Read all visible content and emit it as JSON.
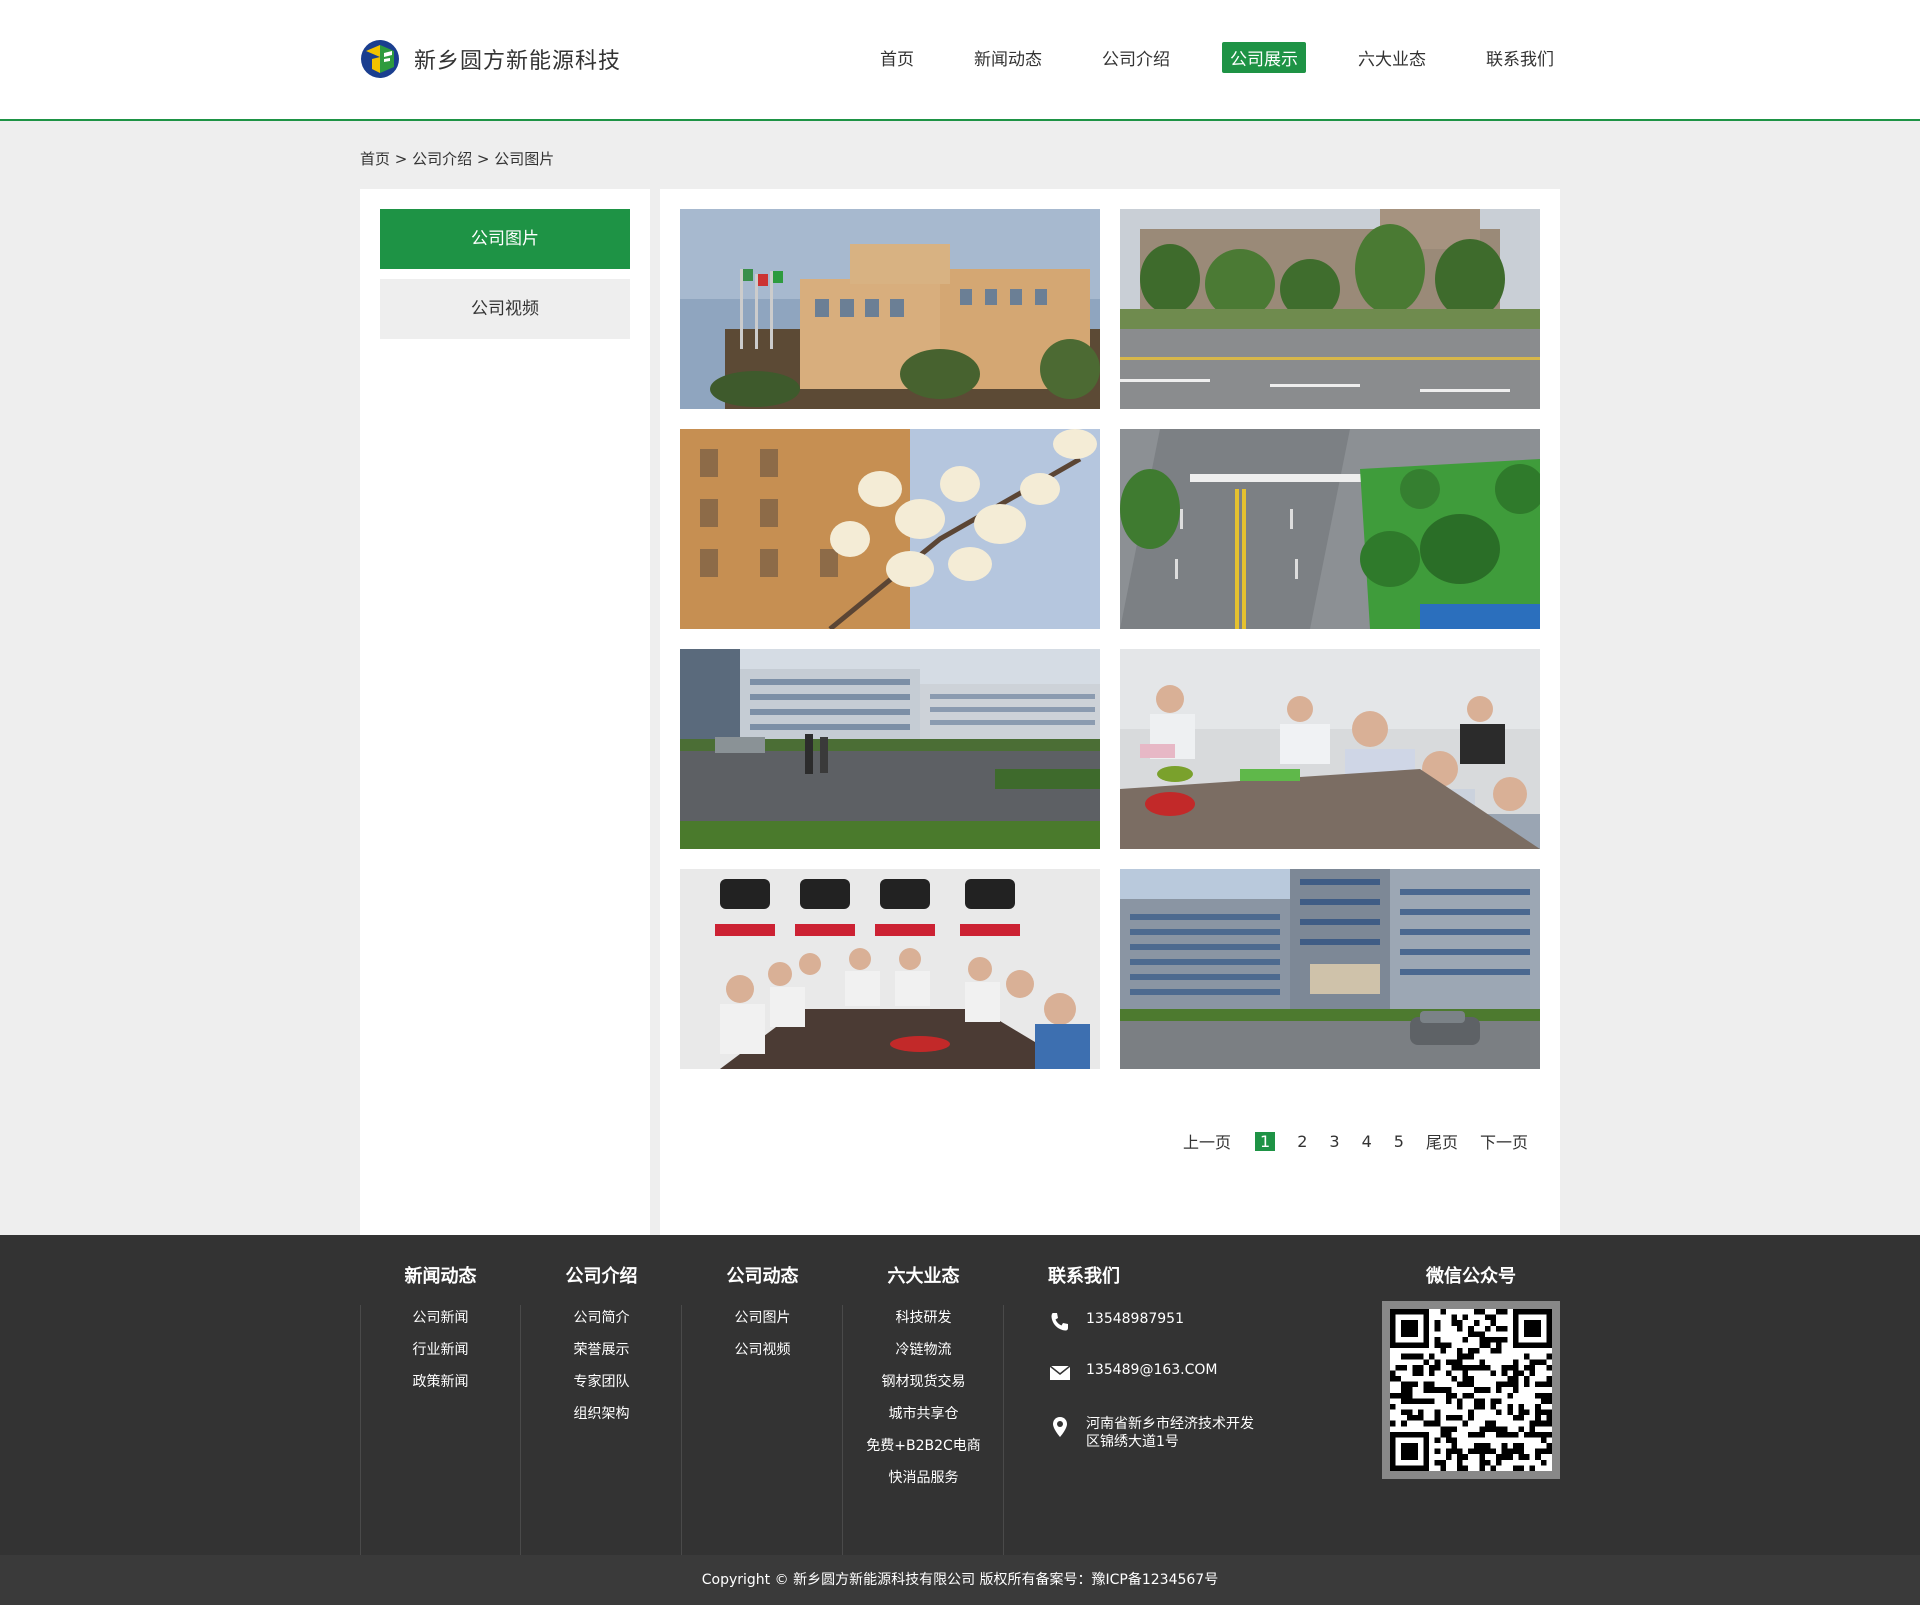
{
  "brand": {
    "name": "新乡圆方新能源科技",
    "accent": "#1e9345"
  },
  "nav": {
    "items": [
      "首页",
      "新闻动态",
      "公司介绍",
      "公司展示",
      "六大业态",
      "联系我们"
    ],
    "active_index": 3
  },
  "breadcrumb": "首页 > 公司介绍 > 公司图片",
  "sidebar": {
    "items": [
      "公司图片",
      "公司视频"
    ],
    "active_index": 0
  },
  "gallery": {
    "photos": [
      "building-with-flags-photo",
      "office-building-road-photo",
      "magnolia-flowers-photo",
      "aerial-road-photo",
      "campus-buildings-photo",
      "meeting-table-photo",
      "conference-room-slogans-photo",
      "modern-office-tower-photo"
    ]
  },
  "pagination": {
    "prev": "上一页",
    "pages": [
      "1",
      "2",
      "3",
      "4",
      "5"
    ],
    "current": "1",
    "last": "尾页",
    "next": "下一页"
  },
  "footer": {
    "columns": [
      {
        "title": "新闻动态",
        "links": [
          "公司新闻",
          "行业新闻",
          "政策新闻"
        ]
      },
      {
        "title": "公司介绍",
        "links": [
          "公司简介",
          "荣誉展示",
          "专家团队",
          "组织架构"
        ]
      },
      {
        "title": "公司动态",
        "links": [
          "公司图片",
          "公司视频"
        ]
      },
      {
        "title": "六大业态",
        "links": [
          "科技研发",
          "冷链物流",
          "钢材现货交易",
          "城市共享仓",
          "免费+B2B2C电商",
          "快消品服务"
        ]
      }
    ],
    "contact": {
      "title": "联系我们",
      "phone": "13548987951",
      "email": "135489@163.COM",
      "address_line1": "河南省新乡市经济技术开发",
      "address_line2": "区锦绣大道1号"
    },
    "wechat_title": "微信公众号"
  },
  "copyright": "Copyright ©    新乡圆方新能源科技有限公司 版权所有备案号：豫ICP备1234567号"
}
